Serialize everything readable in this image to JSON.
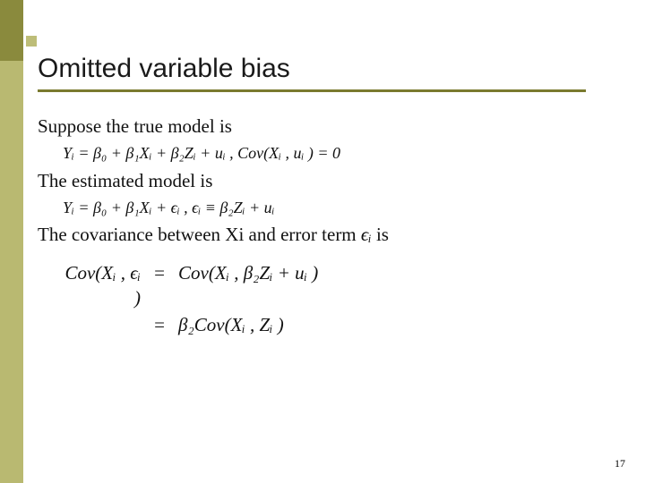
{
  "title": "Omitted variable bias",
  "p1": "Suppose the true model is",
  "eq1": "Yᵢ = β₀ + β₁Xᵢ + β₂Zᵢ + uᵢ ,   Cov(Xᵢ , uᵢ ) = 0",
  "p2": "The estimated model is",
  "eq2": "Yᵢ = β₀ + β₁Xᵢ + ϵᵢ ,   ϵᵢ ≡ β₂Zᵢ + uᵢ",
  "p3_a": "The covariance between Xi and error term",
  "p3_eps": "ϵᵢ",
  "p3_b": " is",
  "cov_label": "Cov(Xᵢ , ϵᵢ )",
  "cov_rhs1": "Cov(Xᵢ , β₂Zᵢ + uᵢ )",
  "cov_rhs2": "β₂Cov(Xᵢ , Zᵢ )",
  "eqsign": "=",
  "page_number": "17"
}
